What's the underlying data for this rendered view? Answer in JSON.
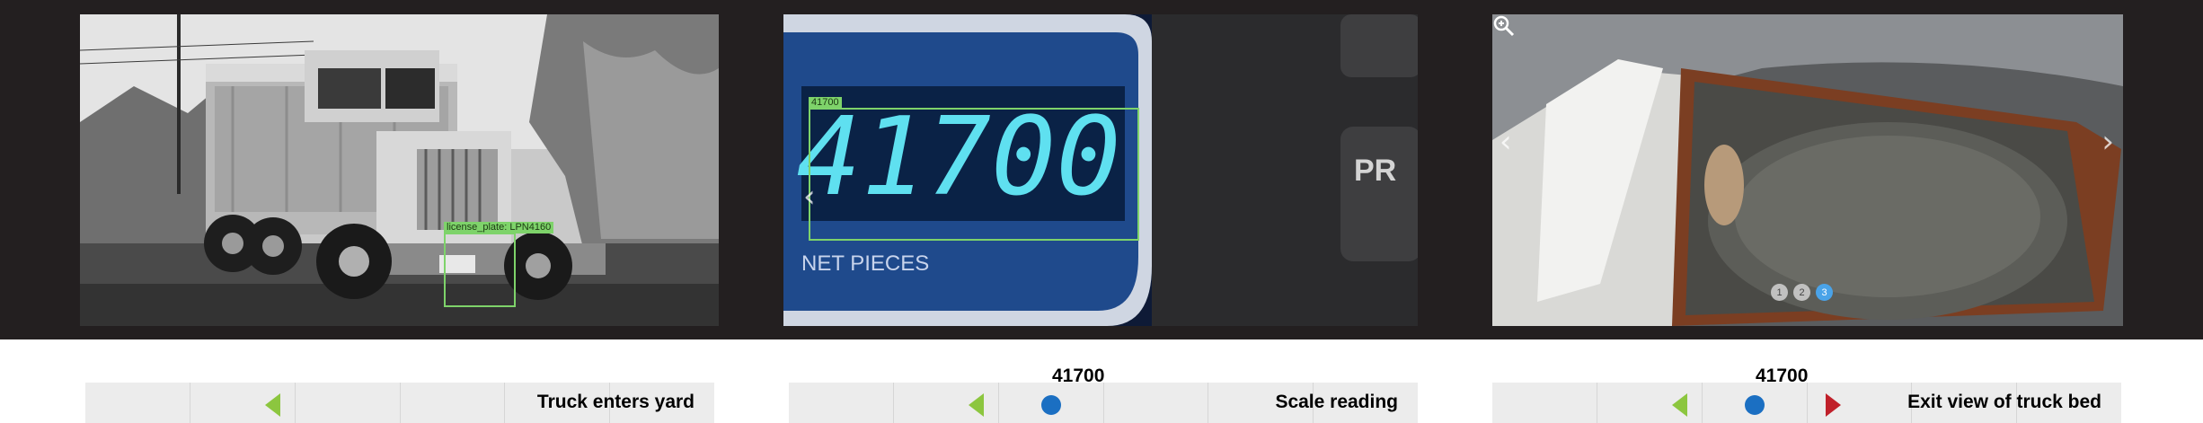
{
  "panels": [
    {
      "detection": {
        "label": "license_plate: LPN4160"
      }
    },
    {
      "detection": {
        "label": "41700"
      },
      "display_text": "41700",
      "display_caption": "NET  PIECES",
      "button_text": "PR"
    },
    {
      "carousel": {
        "pages": [
          "1",
          "2",
          "3"
        ],
        "active_page": "3"
      }
    }
  ],
  "timeline": [
    {
      "label": "Truck enters yard",
      "value": "",
      "markers": [
        "green-left-triangle"
      ]
    },
    {
      "label": "Scale reading",
      "value": "41700",
      "markers": [
        "green-left-triangle",
        "blue-dot"
      ]
    },
    {
      "label": "Exit view of truck bed",
      "value": "41700",
      "markers": [
        "green-left-triangle",
        "blue-dot",
        "red-right-triangle"
      ]
    }
  ],
  "colors": {
    "background_band": "#231f20",
    "detection_box": "#7ed36a",
    "green_marker": "#8cc63f",
    "blue_marker": "#1b6fc2",
    "red_marker": "#c0202a",
    "active_dot": "#4aa3e8",
    "bar": "#ececec"
  },
  "icons": [
    "chevron-left-icon",
    "chevron-right-icon",
    "zoom-icon"
  ]
}
